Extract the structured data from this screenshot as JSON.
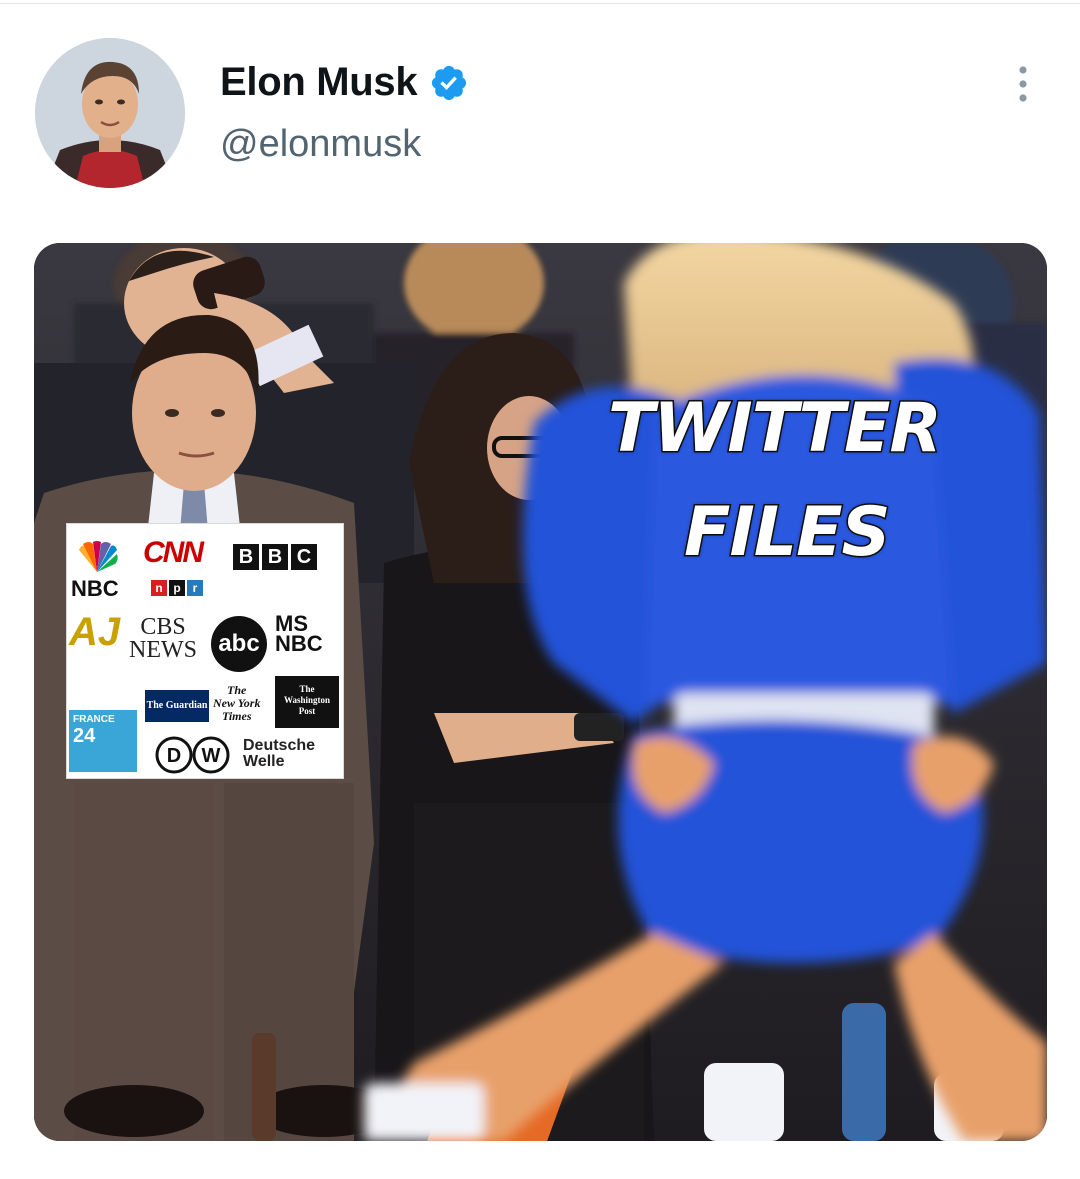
{
  "author": {
    "display_name": "Elon Musk",
    "handle": "@elonmusk",
    "verified": true,
    "avatar_icon": "profile-photo",
    "verified_icon": "verified-badge-icon",
    "verified_color": "#1d9bf0"
  },
  "menu": {
    "icon": "more-options-icon"
  },
  "media": {
    "overlay_line1": "TWITTER",
    "overlay_line2": "FILES",
    "logo_panel": {
      "cnn": "CNN",
      "bbc": [
        "B",
        "B",
        "C"
      ],
      "nbc": "NBC",
      "npr": [
        "n",
        "p",
        "r"
      ],
      "aj": "AJ",
      "cbs": "CBS\nNEWS",
      "abc": "abc",
      "msnbc": "MS\nNBC",
      "guardian": "The Guardian",
      "nyt": "The\nNew York\nTimes",
      "wapo": "The\nWashington\nPost",
      "f24_top": "FRANCE",
      "f24_num": "24",
      "dw": "DW",
      "dw_name": "Deutsche\nWelle"
    }
  },
  "colors": {
    "text_primary": "#0f1419",
    "text_secondary": "#536471",
    "verified": "#1d9bf0",
    "cheer_blue": "#1f4fd8",
    "skin": "#e8a06a"
  }
}
